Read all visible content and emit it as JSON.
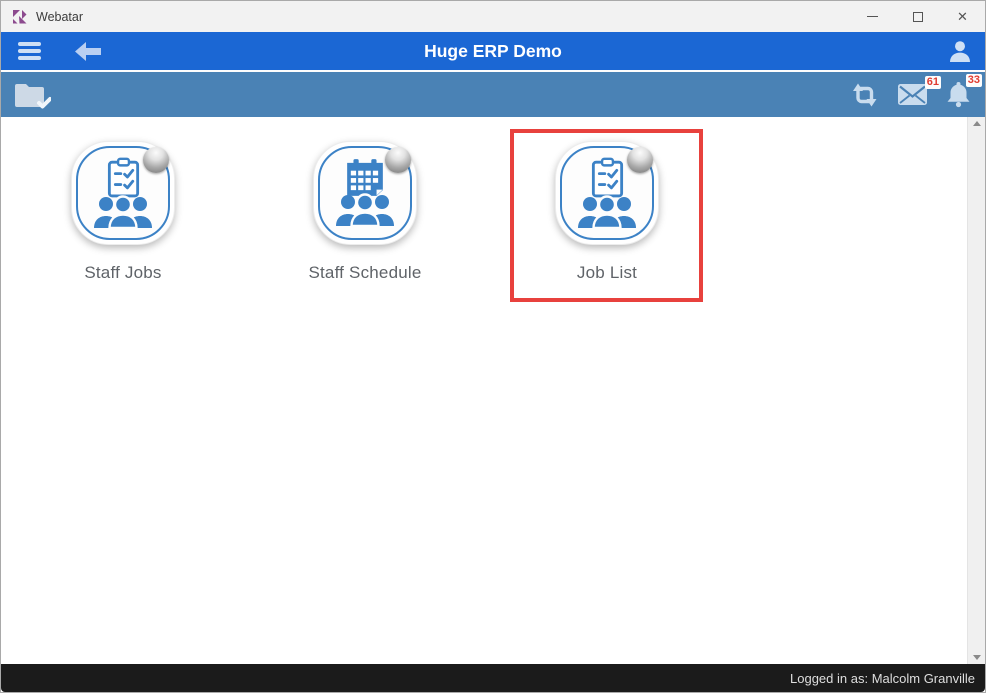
{
  "titlebar": {
    "app_name": "Webatar",
    "icons": {
      "logo": "webatar-logo",
      "window_controls": [
        "minimize",
        "maximize",
        "close"
      ]
    }
  },
  "header": {
    "title": "Huge ERP Demo",
    "icons": {
      "left": [
        "hamburger-menu",
        "back-arrow"
      ],
      "right": [
        "user-profile"
      ]
    }
  },
  "toolbar": {
    "icons": {
      "left": [
        "folder-check"
      ],
      "right": [
        "refresh-loop",
        "mail-envelope",
        "notification-bell"
      ]
    },
    "mail_badge": "61",
    "notifications_badge": "33"
  },
  "content": {
    "tiles": [
      {
        "label": "Staff Jobs",
        "icon": "clipboard-checklist-group",
        "highlighted": false
      },
      {
        "label": "Staff Schedule",
        "icon": "calendar-group",
        "highlighted": false
      },
      {
        "label": "Job List",
        "icon": "clipboard-checklist-group",
        "highlighted": true
      }
    ]
  },
  "statusbar": {
    "text": "Logged in as: Malcolm Granville"
  },
  "colors": {
    "header_blue": "#1b67d4",
    "toolbar_blue": "#4a82b5",
    "tile_blue": "#3c82c6",
    "icon_light_blue": "#ccdcec",
    "highlight_red": "#e8413d",
    "badge_red": "#e03c31",
    "statusbar_black": "#1b1b1b"
  }
}
